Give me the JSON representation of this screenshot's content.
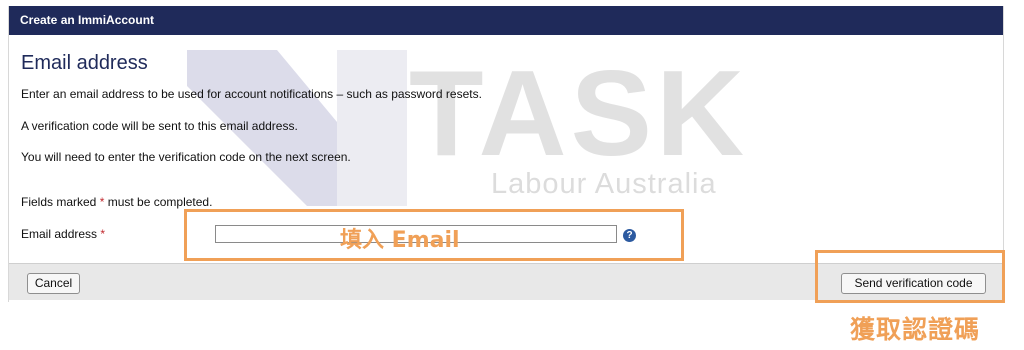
{
  "window": {
    "title": "Create an ImmiAccount"
  },
  "watermark": {
    "brand": "TASK",
    "subtitle": "Labour Australia"
  },
  "form": {
    "heading": "Email address",
    "paragraphs": [
      "Enter an email address to be used for account notifications – such as password resets.",
      "A verification code will be sent to this email address.",
      "You will need to enter the verification code on the next screen."
    ],
    "fields_note_prefix": "Fields marked ",
    "required_marker": "*",
    "fields_note_suffix": " must be completed.",
    "email_label": "Email address",
    "email_value": "",
    "help_icon": "?"
  },
  "footer": {
    "cancel_label": "Cancel",
    "send_label": "Send verification code"
  },
  "annotations": {
    "email_hint": "填入 Email",
    "send_hint": "獲取認證碼"
  },
  "colors": {
    "titlebar": "#1f2a5a",
    "heading": "#1f2a5a",
    "required": "#c0282d",
    "annotation": "#f0a057"
  }
}
